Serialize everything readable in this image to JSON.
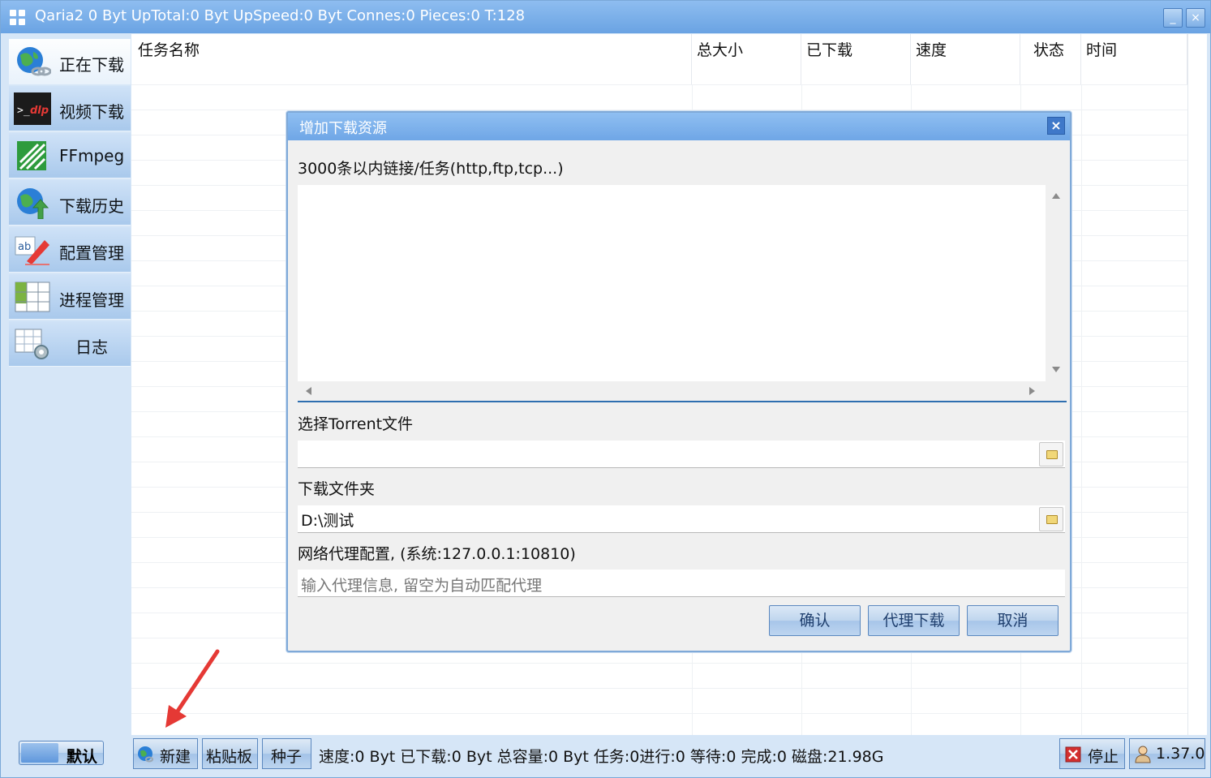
{
  "window": {
    "title": "Qaria2 0 Byt UpTotal:0 Byt UpSpeed:0 Byt Connes:0 Pieces:0 T:128",
    "minimize_glyph": "_",
    "close_glyph": "×"
  },
  "sidebar": {
    "items": [
      {
        "label": "正在下载",
        "icon": "globe-link-icon",
        "active": true
      },
      {
        "label": "视频下载",
        "icon": "ytdlp-icon"
      },
      {
        "label": "FFmpeg",
        "icon": "ffmpeg-icon"
      },
      {
        "label": "下载历史",
        "icon": "globe-upload-icon"
      },
      {
        "label": "配置管理",
        "icon": "edit-pen-icon"
      },
      {
        "label": "进程管理",
        "icon": "grid-table-icon"
      },
      {
        "label": "日志",
        "icon": "log-gear-icon"
      }
    ],
    "default_button": "默认"
  },
  "table": {
    "columns": [
      "任务名称",
      "总大小",
      "已下载",
      "速度",
      "状态",
      "时间"
    ]
  },
  "dialog": {
    "title": "增加下载资源",
    "links_label": "3000条以内链接/任务(http,ftp,tcp...)",
    "links_value": "",
    "torrent_label": "选择Torrent文件",
    "torrent_value": "",
    "folder_label": "下载文件夹",
    "folder_value": "D:\\测试",
    "proxy_label": "网络代理配置, (系统:127.0.0.1:10810)",
    "proxy_placeholder": "输入代理信息, 留空为自动匹配代理",
    "confirm_button": "确认",
    "proxy_download_button": "代理下载",
    "cancel_button": "取消",
    "close_glyph": "×"
  },
  "statusbar": {
    "new_button": "新建",
    "paste_button": "粘贴板",
    "seed_button": "种子",
    "status_text": "速度:0 Byt 已下载:0 Byt 总容量:0 Byt 任务:0进行:0 等待:0 完成:0 磁盘:21.98G",
    "stop_button": "停止",
    "version": "1.37.0"
  },
  "colors": {
    "accent": "#6aa3e3",
    "annotation_arrow": "#e53935",
    "stop_red": "#d32f2f"
  }
}
